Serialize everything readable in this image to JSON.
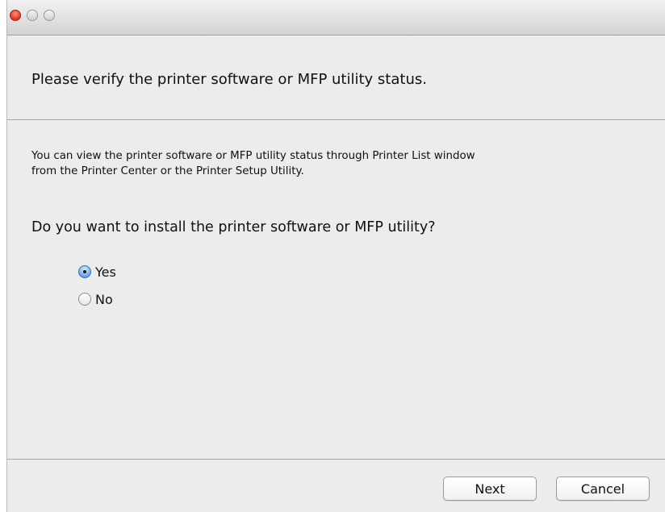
{
  "window": {
    "title": "",
    "traffic_lights": [
      "close",
      "minimize",
      "zoom"
    ]
  },
  "content": {
    "heading": "Please verify the printer software or MFP utility status.",
    "description_line1": "You can view the printer software or MFP utility status through Printer List window",
    "description_line2": "from the Printer Center or the Printer Setup Utility.",
    "question": "Do you want to install the printer software or MFP utility?",
    "options": [
      {
        "label": "Yes",
        "selected": true
      },
      {
        "label": "No",
        "selected": false
      }
    ]
  },
  "footer": {
    "next_label": "Next",
    "cancel_label": "Cancel"
  },
  "colors": {
    "window_bg": "#ececec",
    "close_button": "#e0412d",
    "selected_radio": "#3f86d6"
  }
}
